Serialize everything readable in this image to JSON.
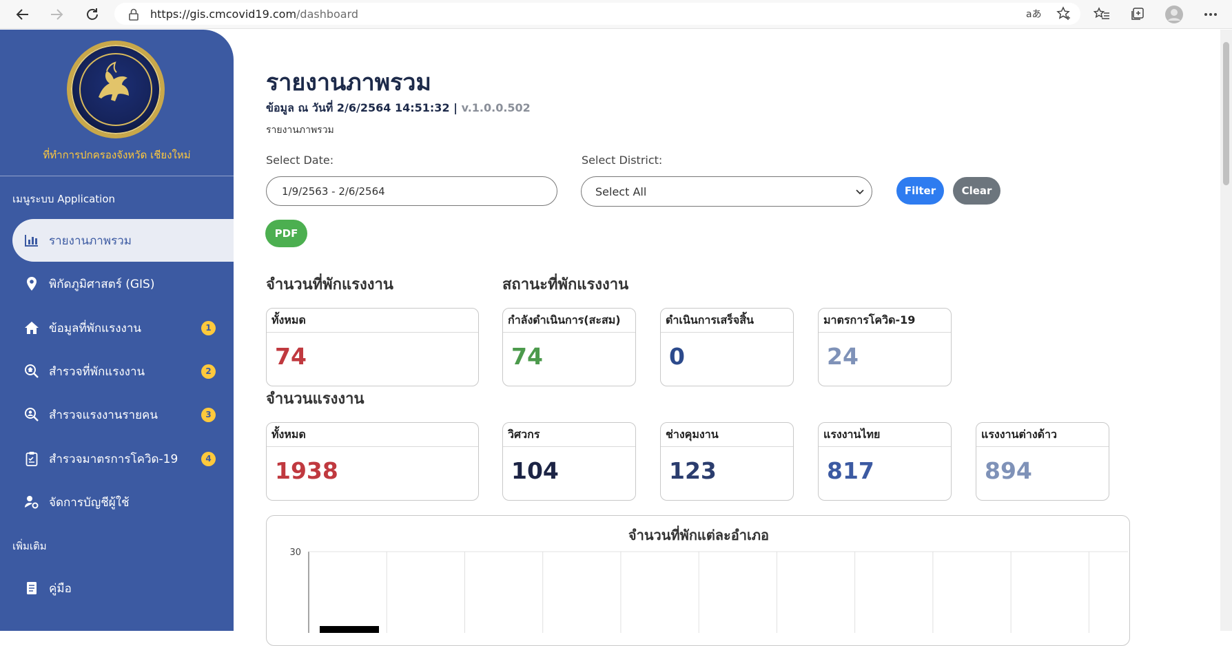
{
  "browser": {
    "url_host": "https://gis.cmcovid19.com",
    "url_path": "/dashboard",
    "icons": [
      "back-icon",
      "forward-icon",
      "reload-icon",
      "lock-icon",
      "read-aloud-icon",
      "add-favorite-icon",
      "favorites-icon",
      "collections-icon",
      "profile-icon",
      "more-icon"
    ]
  },
  "sidebar": {
    "org_name": "ที่ทำการปกครองจังหวัด เชียงใหม่",
    "group_app": "เมนูระบบ Application",
    "items": [
      {
        "label": "รายงานภาพรวม",
        "icon": "bar-chart-icon",
        "badge": ""
      },
      {
        "label": "พิกัดภูมิศาสตร์ (GIS)",
        "icon": "map-pin-icon",
        "badge": ""
      },
      {
        "label": "ข้อมูลที่พักแรงงาน",
        "icon": "home-icon",
        "badge": "1"
      },
      {
        "label": "สำรวจที่พักแรงงาน",
        "icon": "search-home-icon",
        "badge": "2"
      },
      {
        "label": "สำรวจแรงงานรายคน",
        "icon": "search-user-icon",
        "badge": "3"
      },
      {
        "label": "สำรวจมาตรการโควิด-19",
        "icon": "clipboard-icon",
        "badge": "4"
      },
      {
        "label": "จัดการบัญชีผู้ใช้",
        "icon": "user-cog-icon",
        "badge": ""
      }
    ],
    "group_more": "เพิ่มเติม",
    "more_items": [
      {
        "label": "คู่มือ",
        "icon": "book-icon"
      }
    ]
  },
  "main": {
    "title": "รายงานภาพรวม",
    "subtitle": "ข้อมูล ณ วันที่ 2/6/2564 14:51:32 | ",
    "version": "v.1.0.0.502",
    "breadcrumb": "รายงานภาพรวม",
    "date_label": "Select Date:",
    "date_value": "1/9/2563 - 2/6/2564",
    "district_label": "Select District:",
    "district_value": "Select All",
    "filter_label": "Filter",
    "clear_label": "Clear",
    "pdf_label": "PDF",
    "section_count": "จำนวนที่พักแรงงาน",
    "section_status": "สถานะที่พักแรงงาน",
    "section_workers": "จำนวนแรงงาน",
    "cards_row1": [
      {
        "title": "ทั้งหมด",
        "value": "74",
        "color": "#c0393f"
      },
      {
        "title": "กำลังดำเนินการ(สะสม)",
        "value": "74",
        "color": "#4c9a4c"
      },
      {
        "title": "ดำเนินการเสร็จสิ้น",
        "value": "0",
        "color": "#2c4a8c"
      },
      {
        "title": "มาตรการโควิด-19",
        "value": "24",
        "color": "#7f92b8"
      }
    ],
    "cards_row2": [
      {
        "title": "ทั้งหมด",
        "value": "1938",
        "color": "#c0393f"
      },
      {
        "title": "วิศวกร",
        "value": "104",
        "color": "#1c2445"
      },
      {
        "title": "ช่างคุมงาน",
        "value": "123",
        "color": "#2b3d6e"
      },
      {
        "title": "แรงงานไทย",
        "value": "817",
        "color": "#3c5aa2"
      },
      {
        "title": "แรงงานต่างด้าว",
        "value": "894",
        "color": "#7f92b8"
      }
    ]
  },
  "chart_data": {
    "type": "bar",
    "title": "จำนวนที่พักแต่ละอำเภอ",
    "ylim_max_label": "30",
    "categories": [
      "",
      "",
      "",
      "",
      "",
      "",
      "",
      "",
      "",
      "",
      ""
    ],
    "values": [
      null,
      null,
      null,
      null,
      null,
      null,
      null,
      null,
      null,
      null,
      null
    ]
  },
  "colors": {
    "sidebar": "#3c5aa2",
    "accent_yellow": "#ffc93c",
    "filter": "#2e7cf0",
    "clear": "#6c757d",
    "pdf": "#4caf50"
  }
}
